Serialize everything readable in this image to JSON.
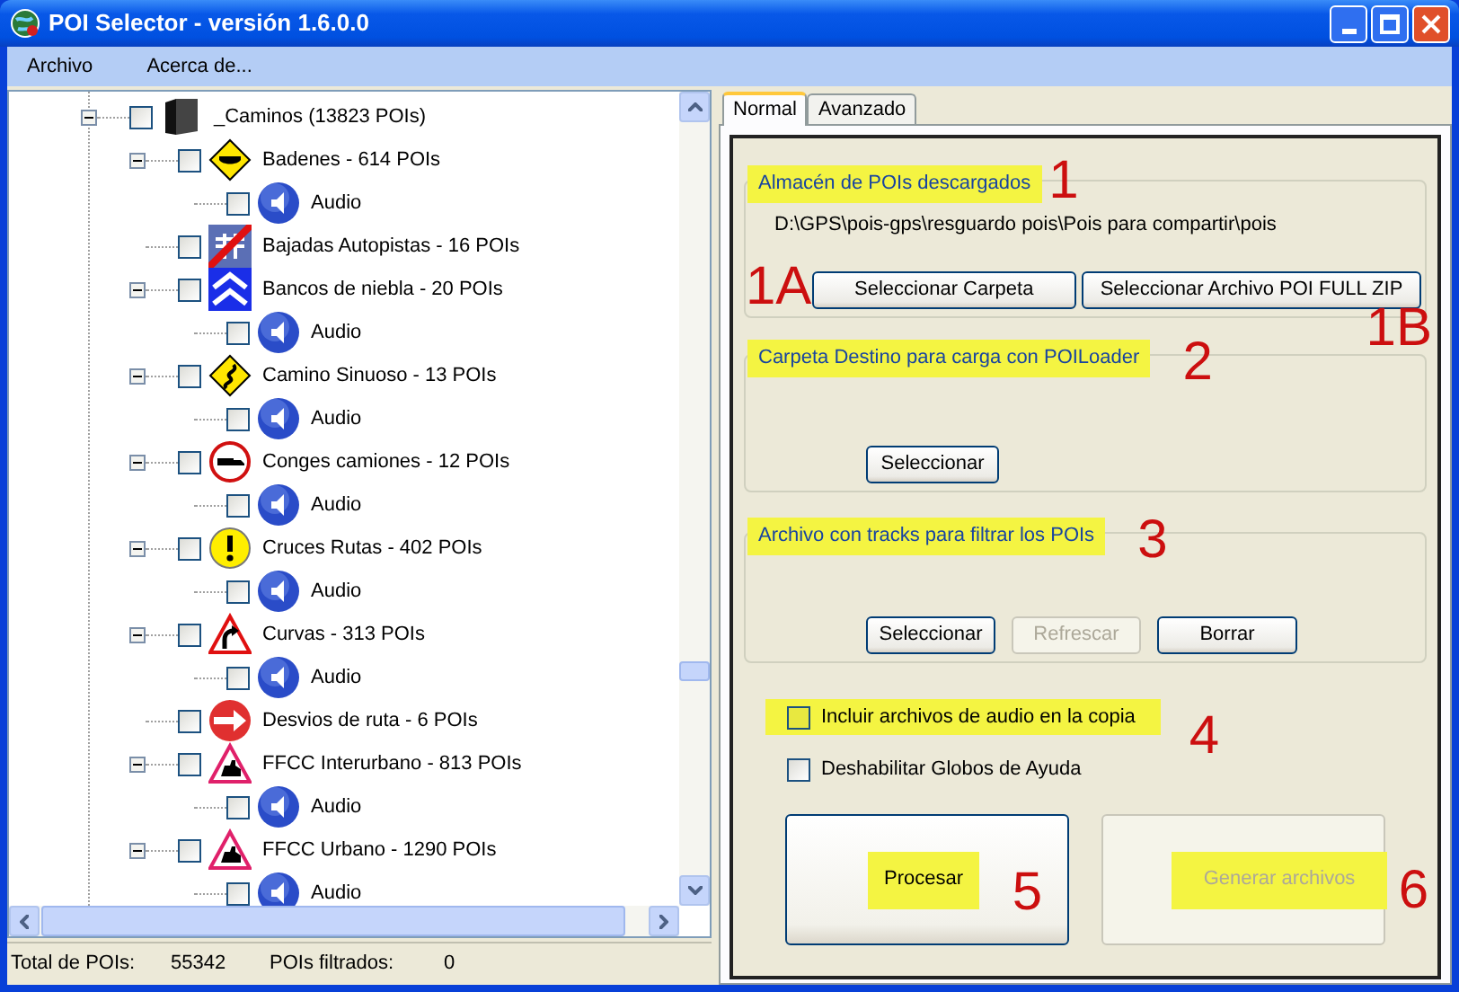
{
  "window": {
    "title": "POI Selector - versión 1.6.0.0"
  },
  "menu": [
    "Archivo",
    "Acerca de..."
  ],
  "tree": {
    "label": "_Caminos (13823 POIs)",
    "checked": false,
    "expanded": true,
    "children": [
      {
        "label": "Badenes - 614 POIs",
        "checked": false,
        "expanded": true,
        "children": [
          {
            "label": "Audio",
            "checked": false
          }
        ]
      },
      {
        "label": "Bajadas Autopistas - 16 POIs",
        "checked": false
      },
      {
        "label": "Bancos de niebla - 20 POIs",
        "checked": false,
        "expanded": true,
        "children": [
          {
            "label": "Audio",
            "checked": false
          }
        ]
      },
      {
        "label": "Camino Sinuoso - 13 POIs",
        "checked": false,
        "expanded": true,
        "children": [
          {
            "label": "Audio",
            "checked": false
          }
        ]
      },
      {
        "label": "Conges camiones - 12 POIs",
        "checked": false,
        "expanded": true,
        "children": [
          {
            "label": "Audio",
            "checked": false
          }
        ]
      },
      {
        "label": "Cruces Rutas - 402 POIs",
        "checked": false,
        "expanded": true,
        "children": [
          {
            "label": "Audio",
            "checked": false
          }
        ]
      },
      {
        "label": "Curvas - 313 POIs",
        "checked": false,
        "expanded": true,
        "children": [
          {
            "label": "Audio",
            "checked": false
          }
        ]
      },
      {
        "label": "Desvios de ruta - 6 POIs",
        "checked": false
      },
      {
        "label": "FFCC Interurbano - 813 POIs",
        "checked": false,
        "expanded": true,
        "children": [
          {
            "label": "Audio",
            "checked": false
          }
        ]
      },
      {
        "label": "FFCC Urbano - 1290 POIs",
        "checked": false,
        "expanded": true,
        "children": [
          {
            "label": "Audio",
            "checked": false
          }
        ]
      }
    ]
  },
  "status_bar": {
    "total_label": "Total de POIs:",
    "total": "55342",
    "filtered_label": "POIs filtrados:",
    "filtered": "0"
  },
  "tabs": [
    {
      "label": "Normal",
      "selected": true
    },
    {
      "label": "Avanzado",
      "selected": false
    }
  ],
  "groups": [
    {
      "legend": "Almacén de POIs descargados",
      "highlighted": true,
      "marker": "1",
      "path": "D:\\GPS\\pois-gps\\resguardo pois\\Pois para compartir\\pois",
      "buttons": [
        {
          "label": "Seleccionar Carpeta",
          "disabled": false,
          "marker": "1A"
        },
        {
          "label": "Seleccionar Archivo POI FULL ZIP",
          "disabled": false,
          "marker": "1B"
        }
      ]
    },
    {
      "legend": "Carpeta Destino para carga con POILoader",
      "highlighted": true,
      "marker": "2",
      "buttons": [
        {
          "label": "Seleccionar",
          "disabled": false
        }
      ]
    },
    {
      "legend": "Archivo con tracks para filtrar los POIs",
      "highlighted": true,
      "marker": "3",
      "buttons": [
        {
          "label": "Seleccionar",
          "disabled": false
        },
        {
          "label": "Refrescar",
          "disabled": true
        },
        {
          "label": "Borrar",
          "disabled": false
        }
      ]
    }
  ],
  "options": [
    {
      "label": "Incluir archivos de audio en la copia",
      "checked": false,
      "highlighted": true,
      "marker": "4"
    },
    {
      "label": "Deshabilitar Globos de Ayuda",
      "checked": false,
      "highlighted": false
    }
  ],
  "actions": [
    {
      "label": "Procesar",
      "disabled": false,
      "highlighted": true,
      "marker": "5"
    },
    {
      "label": "Generar archivos",
      "disabled": true,
      "highlighted": true,
      "marker": "6"
    }
  ]
}
